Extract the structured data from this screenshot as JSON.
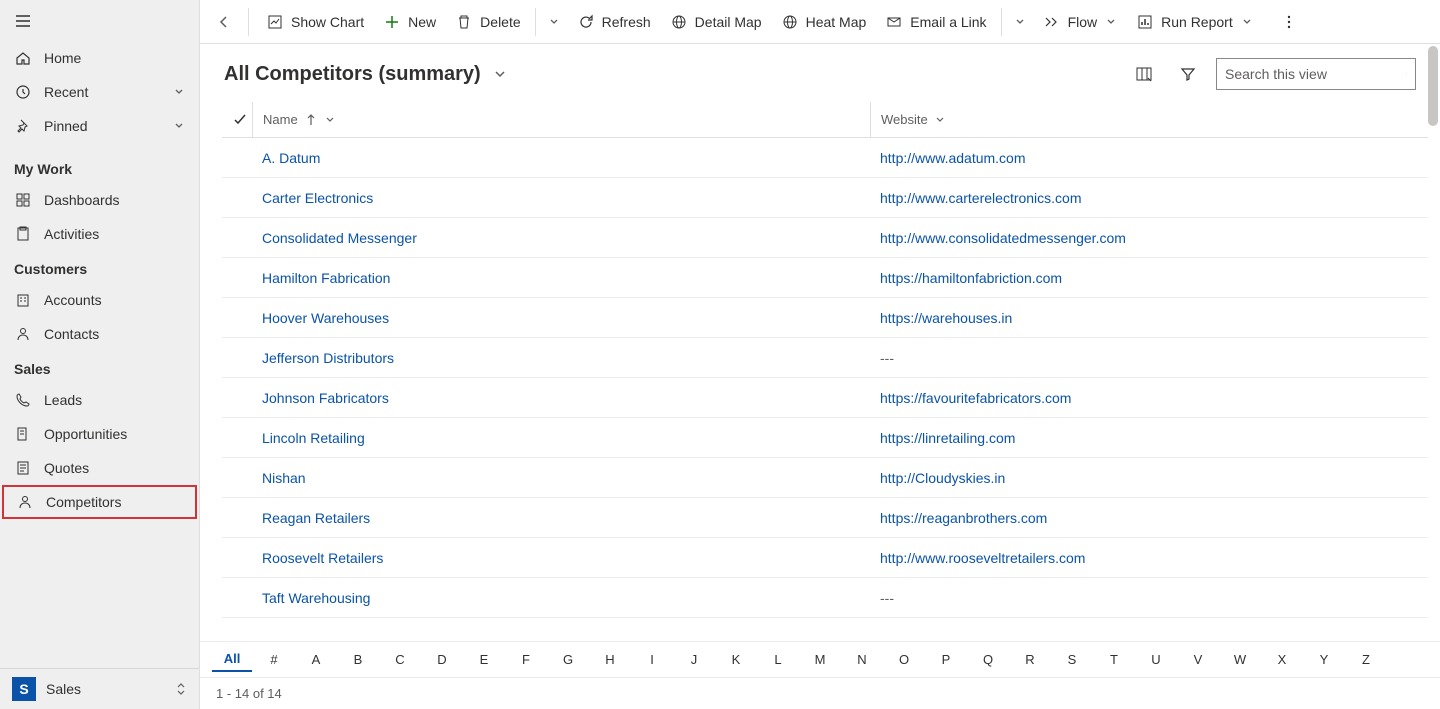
{
  "sidebar": {
    "top_items": [
      {
        "label": "Home",
        "icon": "home"
      },
      {
        "label": "Recent",
        "icon": "clock",
        "chevron": true
      },
      {
        "label": "Pinned",
        "icon": "pin",
        "chevron": true
      }
    ],
    "groups": [
      {
        "header": "My Work",
        "items": [
          {
            "label": "Dashboards",
            "icon": "dashboard"
          },
          {
            "label": "Activities",
            "icon": "clipboard"
          }
        ]
      },
      {
        "header": "Customers",
        "items": [
          {
            "label": "Accounts",
            "icon": "building"
          },
          {
            "label": "Contacts",
            "icon": "person"
          }
        ]
      },
      {
        "header": "Sales",
        "items": [
          {
            "label": "Leads",
            "icon": "phone"
          },
          {
            "label": "Opportunities",
            "icon": "target"
          },
          {
            "label": "Quotes",
            "icon": "quote"
          },
          {
            "label": "Competitors",
            "icon": "person",
            "highlighted": true
          }
        ]
      }
    ],
    "footer": {
      "badge": "S",
      "label": "Sales"
    }
  },
  "commandbar": {
    "buttons": [
      {
        "label": "Show Chart",
        "icon": "chart"
      },
      {
        "label": "New",
        "icon": "plus",
        "color": "#107c10"
      },
      {
        "label": "Delete",
        "icon": "trash",
        "split": true
      },
      {
        "label": "Refresh",
        "icon": "refresh"
      },
      {
        "label": "Detail Map",
        "icon": "globe"
      },
      {
        "label": "Heat Map",
        "icon": "globe"
      },
      {
        "label": "Email a Link",
        "icon": "mail",
        "split": true
      },
      {
        "label": "Flow",
        "icon": "flow",
        "chevron": true
      },
      {
        "label": "Run Report",
        "icon": "report",
        "chevron": true
      }
    ]
  },
  "view": {
    "title": "All Competitors (summary)",
    "search_placeholder": "Search this view",
    "columns": {
      "name": "Name",
      "website": "Website"
    },
    "rows": [
      {
        "name": "A. Datum",
        "website": "http://www.adatum.com"
      },
      {
        "name": "Carter Electronics",
        "website": "http://www.carterelectronics.com"
      },
      {
        "name": "Consolidated Messenger",
        "website": "http://www.consolidatedmessenger.com"
      },
      {
        "name": "Hamilton Fabrication",
        "website": "https://hamiltonfabriction.com"
      },
      {
        "name": "Hoover Warehouses",
        "website": "https://warehouses.in"
      },
      {
        "name": "Jefferson Distributors",
        "website": "---"
      },
      {
        "name": "Johnson Fabricators",
        "website": "https://favouritefabricators.com"
      },
      {
        "name": "Lincoln Retailing",
        "website": "https://linretailing.com"
      },
      {
        "name": "Nishan",
        "website": "http://Cloudyskies.in"
      },
      {
        "name": "Reagan Retailers",
        "website": "https://reaganbrothers.com"
      },
      {
        "name": "Roosevelt Retailers",
        "website": "http://www.rooseveltretailers.com"
      },
      {
        "name": "Taft Warehousing",
        "website": "---"
      }
    ],
    "alpha_all": "All",
    "alpha_hash": "#",
    "footer": "1 - 14 of 14"
  }
}
